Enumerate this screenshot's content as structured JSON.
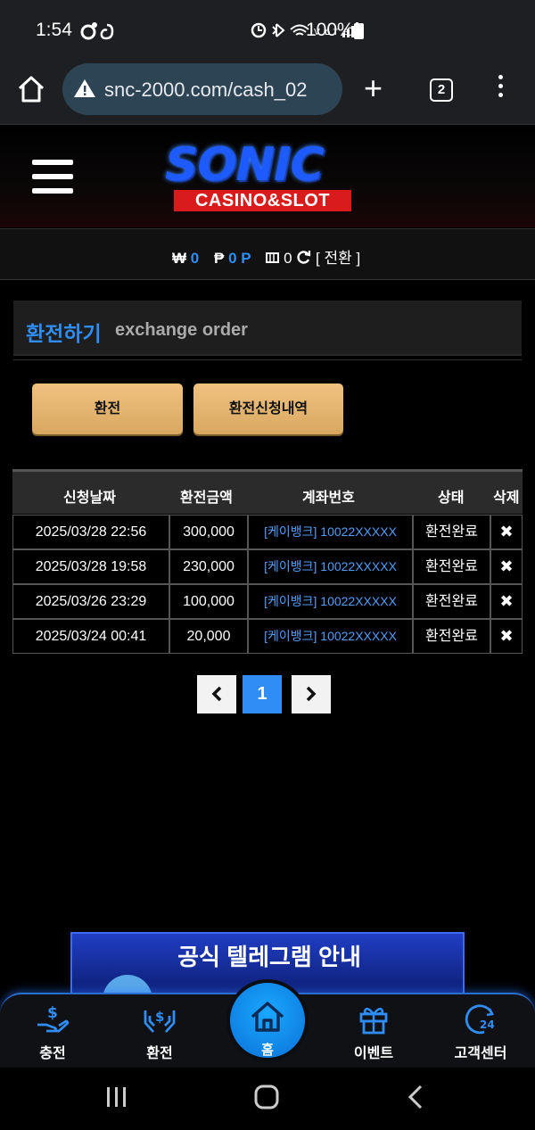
{
  "status_bar": {
    "time": "1:54",
    "battery": "100%"
  },
  "browser": {
    "url": "snc-2000.com/cash_02",
    "tab_count": "2"
  },
  "site": {
    "logo_main": "SONIC",
    "logo_sub": "CASINO&SLOT"
  },
  "balance": {
    "won_symbol": "₩",
    "won_value": "0",
    "point_symbol": "₱",
    "point_value": "0 P",
    "chip_value": "0",
    "convert_label": "[ 전환 ]"
  },
  "title": {
    "ko": "환전하기",
    "en": "exchange order"
  },
  "actions": {
    "exchange_label": "환전",
    "history_label": "환전신청내역"
  },
  "table": {
    "headers": [
      "신청날짜",
      "환전금액",
      "계좌번호",
      "상태",
      "삭제"
    ],
    "rows": [
      {
        "date": "2025/03/28 22:56",
        "amount": "300,000",
        "account": "[케이뱅크] 10022XXXXX",
        "status": "환전완료",
        "delete": "✖"
      },
      {
        "date": "2025/03/28 19:58",
        "amount": "230,000",
        "account": "[케이뱅크] 10022XXXXX",
        "status": "환전완료",
        "delete": "✖"
      },
      {
        "date": "2025/03/26 23:29",
        "amount": "100,000",
        "account": "[케이뱅크] 10022XXXXX",
        "status": "환전완료",
        "delete": "✖"
      },
      {
        "date": "2025/03/24 00:41",
        "amount": "20,000",
        "account": "[케이뱅크] 10022XXXXX",
        "status": "환전완료",
        "delete": "✖"
      }
    ]
  },
  "pagination": {
    "current": "1"
  },
  "banner": {
    "title": "공식 텔레그램 안내"
  },
  "bottom_nav": {
    "charge": "충전",
    "exchange": "환전",
    "home": "홈",
    "event": "이벤트",
    "support": "고객센터"
  },
  "colors": {
    "accent": "#2f8df5",
    "gold": "#e6b56f",
    "logo_red": "#d91b1b"
  }
}
